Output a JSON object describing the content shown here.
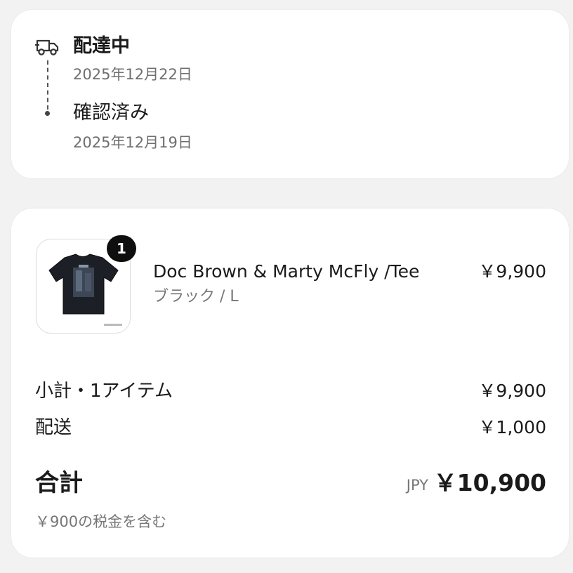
{
  "status": {
    "current": {
      "label": "配達中",
      "date": "2025年12月22日"
    },
    "previous": {
      "label": "確認済み",
      "date": "2025年12月19日"
    },
    "icon": "delivery-truck-icon"
  },
  "item": {
    "quantity": "1",
    "name": "Doc Brown & Marty McFly /Tee",
    "variant": "ブラック / L",
    "price": "￥9,900"
  },
  "summary": {
    "subtotal_label": "小計・1アイテム",
    "subtotal_value": "￥9,900",
    "shipping_label": "配送",
    "shipping_value": "￥1,000",
    "total_label": "合計",
    "currency": "JPY",
    "total_value": "￥10,900",
    "tax_note": "￥900の税金を含む"
  },
  "colors": {
    "background": "#f2f2f2",
    "card": "#ffffff",
    "badge": "#0f0f0f",
    "muted_text": "#777777"
  }
}
